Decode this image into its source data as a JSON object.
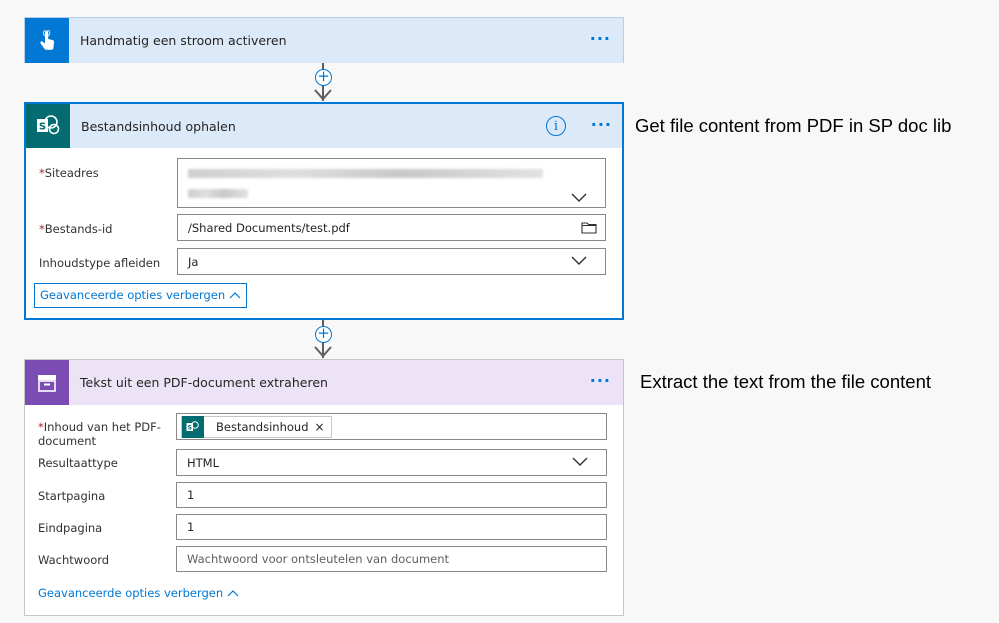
{
  "trigger": {
    "title": "Handmatig een stroom activeren",
    "more": "···",
    "color": "#0078d4"
  },
  "step1": {
    "title": "Bestandsinhoud ophalen",
    "more": "···",
    "info": "i",
    "color": "#036c70",
    "annotation": "Get file content from PDF in SP doc lib",
    "fields": {
      "site_label": "Siteadres",
      "file_label": "Bestands-id",
      "file_value": "/Shared Documents/test.pdf",
      "content_type_label": "Inhoudstype afleiden",
      "content_type_value": "Ja"
    },
    "advanced": "Geavanceerde opties verbergen"
  },
  "step2": {
    "title": "Tekst uit een PDF-document extraheren",
    "more": "···",
    "color": "#7b4db4",
    "annotation": "Extract the text from the file content",
    "fields": {
      "content_label_1": "Inhoud van het PDF-",
      "content_label_2": "document",
      "content_token": "Bestandsinhoud",
      "result_type_label": "Resultaattype",
      "result_type_value": "HTML",
      "start_label": "Startpagina",
      "start_value": "1",
      "end_label": "Eindpagina",
      "end_value": "1",
      "password_label": "Wachtwoord",
      "password_placeholder": "Wachtwoord voor ontsleutelen van document"
    },
    "advanced": "Geavanceerde opties verbergen"
  },
  "required_marker": "*",
  "token_remove": "×",
  "add_step": "+"
}
